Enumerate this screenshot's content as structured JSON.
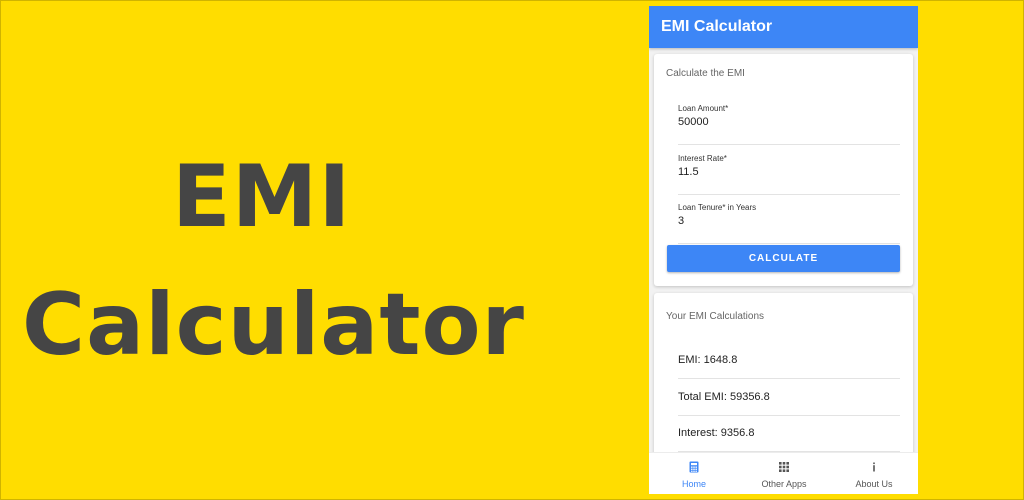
{
  "hero": {
    "line1": "EMI",
    "line2": "Calculator"
  },
  "colors": {
    "background": "#FFDD00",
    "primary": "#3d86f6",
    "hero_text": "#454545"
  },
  "app": {
    "title": "EMI Calculator",
    "form": {
      "heading": "Calculate the EMI",
      "fields": [
        {
          "label": "Loan Amount*",
          "value": "50000"
        },
        {
          "label": "Interest Rate*",
          "value": "11.5"
        },
        {
          "label": "Loan Tenure* in Years",
          "value": "3"
        }
      ],
      "button_label": "CALCULATE"
    },
    "results": {
      "heading": "Your EMI Calculations",
      "rows": [
        "EMI: 1648.8",
        "Total EMI: 59356.8",
        "Interest: 9356.8"
      ]
    },
    "nav": [
      {
        "label": "Home",
        "icon": "calculator-icon",
        "active": true
      },
      {
        "label": "Other Apps",
        "icon": "apps-grid-icon",
        "active": false
      },
      {
        "label": "About Us",
        "icon": "info-icon",
        "active": false
      }
    ]
  }
}
